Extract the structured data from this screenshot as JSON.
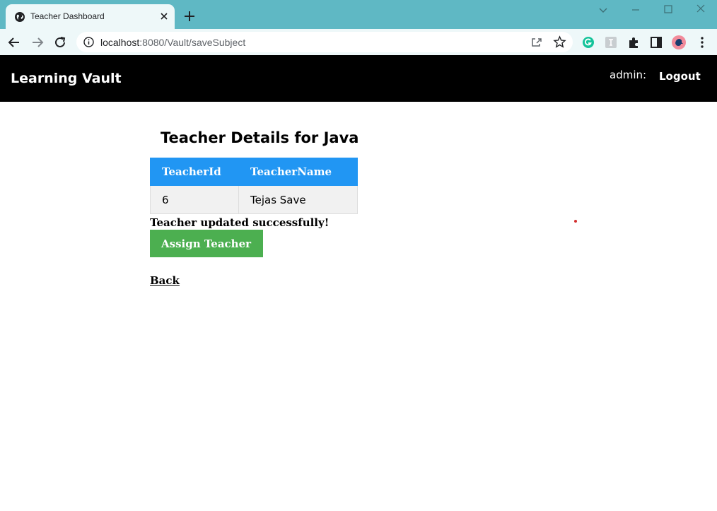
{
  "browser": {
    "tab_title": "Teacher Dashboard",
    "url_host": "localhost",
    "url_rest": ":8080/Vault/saveSubject",
    "extensions": [
      "grammarly-icon",
      "translate-extension-icon",
      "puzzle-extensions-icon",
      "side-panel-icon",
      "profile-avatar-icon",
      "more-menu-icon"
    ]
  },
  "navbar": {
    "brand": "Learning Vault",
    "user_label": "admin:",
    "logout_label": "Logout"
  },
  "main": {
    "heading": "Teacher Details for Java",
    "table": {
      "headers": [
        "TeacherId",
        "TeacherName"
      ],
      "rows": [
        [
          "6",
          "Tejas Save"
        ]
      ]
    },
    "status_message": "Teacher updated successfully!",
    "assign_button_label": "Assign Teacher",
    "back_link_label": "Back"
  },
  "colors": {
    "navbar_bg": "#000000",
    "table_header_bg": "#2196f3",
    "assign_button_bg": "#4caf50",
    "tabbar_bg": "#5fb8c4"
  }
}
